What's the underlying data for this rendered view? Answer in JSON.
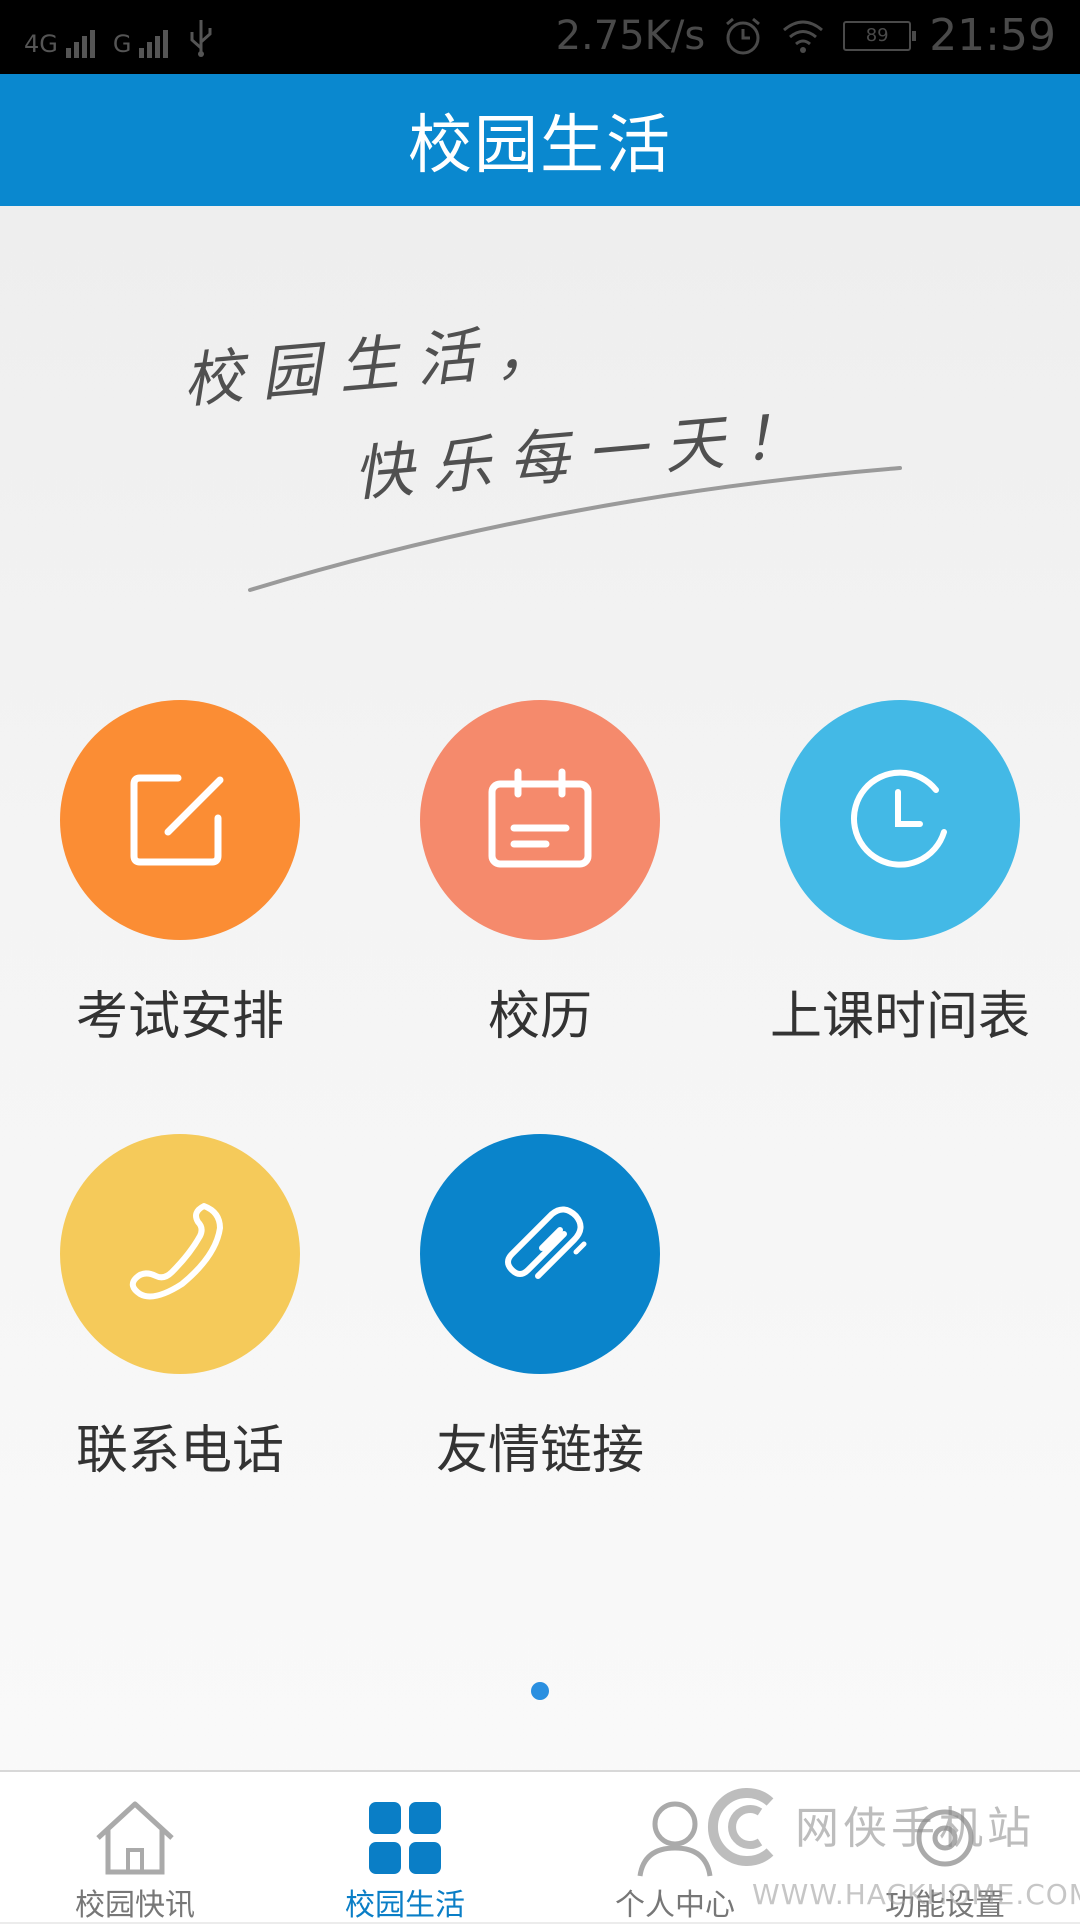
{
  "status_bar": {
    "sim1_label": "4G",
    "sim2_label": "G",
    "net_speed": "2.75K/s",
    "battery": "89",
    "time": "21:59"
  },
  "header": {
    "title": "校园生活"
  },
  "banner": {
    "line1": "校园生活，",
    "line2": "快乐每一天！"
  },
  "grid": {
    "items": [
      {
        "label": "考试安排",
        "icon": "edit-icon",
        "color": "#fb8d34"
      },
      {
        "label": "校历",
        "icon": "calendar-icon",
        "color": "#f58a6c"
      },
      {
        "label": "上课时间表",
        "icon": "clock-icon",
        "color": "#43b9e6"
      },
      {
        "label": "联系电话",
        "icon": "phone-icon",
        "color": "#f5ca5a"
      },
      {
        "label": "友情链接",
        "icon": "paperclip-icon",
        "color": "#0a84cb"
      }
    ]
  },
  "pager": {
    "pages": 1,
    "current": 1
  },
  "bottom_nav": {
    "items": [
      {
        "label": "校园快讯",
        "icon": "home-icon",
        "active": false
      },
      {
        "label": "校园生活",
        "icon": "grid-icon",
        "active": true
      },
      {
        "label": "个人中心",
        "icon": "user-icon",
        "active": false
      },
      {
        "label": "功能设置",
        "icon": "settings-icon",
        "active": false
      }
    ]
  },
  "watermark": {
    "name": "网侠手机站",
    "url": "WWW.HACKHOME.COM"
  },
  "colors": {
    "primary": "#0a88cf",
    "active_nav": "#0a7ec6"
  }
}
